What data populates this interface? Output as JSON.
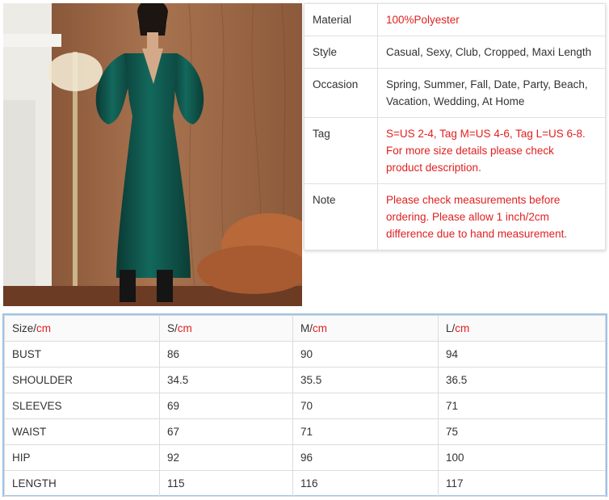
{
  "image": {
    "alt": "Model in green satin dress",
    "colors": {
      "wall": "#9a6848",
      "dress": "#0e4a42",
      "chair": "#b9683a",
      "fireplace": "#ecebe6"
    }
  },
  "spec": {
    "material_label": "Material",
    "material_value": "100%Polyester",
    "style_label": "Style",
    "style_value": "Casual, Sexy, Club, Cropped, Maxi Length",
    "occasion_label": "Occasion",
    "occasion_value_1": "Spring, Summer, Fall, Date, Party, Beach,",
    "occasion_value_2": "Vacation, Wedding, At Home",
    "tag_label": "Tag",
    "tag_value_1": "S=US 2-4, Tag M=US 4-6, Tag L=US 6-8.",
    "tag_value_2": "For more size details please check",
    "tag_value_3": "product description.",
    "note_label": "Note",
    "note_value_1": "Please check measurements before",
    "note_value_2": "ordering. Please allow 1 inch/2cm",
    "note_value_3": "difference due to hand measurement."
  },
  "size_table": {
    "headers": [
      {
        "name": "Size/",
        "unit": "cm"
      },
      {
        "name": "S/",
        "unit": "cm"
      },
      {
        "name": "M/",
        "unit": "cm"
      },
      {
        "name": "L/",
        "unit": "cm"
      }
    ],
    "rows": [
      [
        "BUST",
        "86",
        "90",
        "94"
      ],
      [
        "SHOULDER",
        "34.5",
        "35.5",
        "36.5"
      ],
      [
        "SLEEVES",
        "69",
        "70",
        "71"
      ],
      [
        "WAIST",
        "67",
        "71",
        "75"
      ],
      [
        "HIP",
        "92",
        "96",
        "100"
      ],
      [
        "LENGTH",
        "115",
        "116",
        "117"
      ]
    ]
  }
}
